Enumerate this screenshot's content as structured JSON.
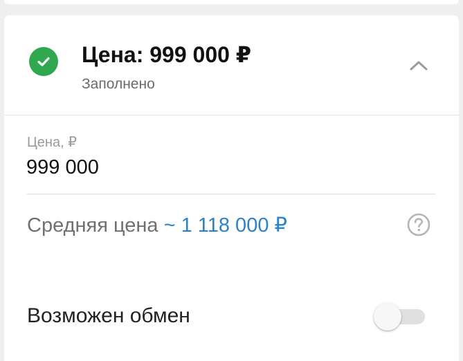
{
  "section": {
    "title": "Цена: 999 000 ₽",
    "status": "Заполнено",
    "status_icon": "check-circle-icon",
    "status_color": "#2fa84f",
    "collapse_icon": "chevron-up-icon"
  },
  "price_field": {
    "label": "Цена, ₽",
    "value": "999 000"
  },
  "average_price": {
    "label": "Средняя цена",
    "value": "~ 1 118 000 ₽",
    "value_color": "#2c82c9",
    "help_icon": "question-circle-icon"
  },
  "exchange": {
    "label": "Возможен обмен",
    "enabled": false
  }
}
